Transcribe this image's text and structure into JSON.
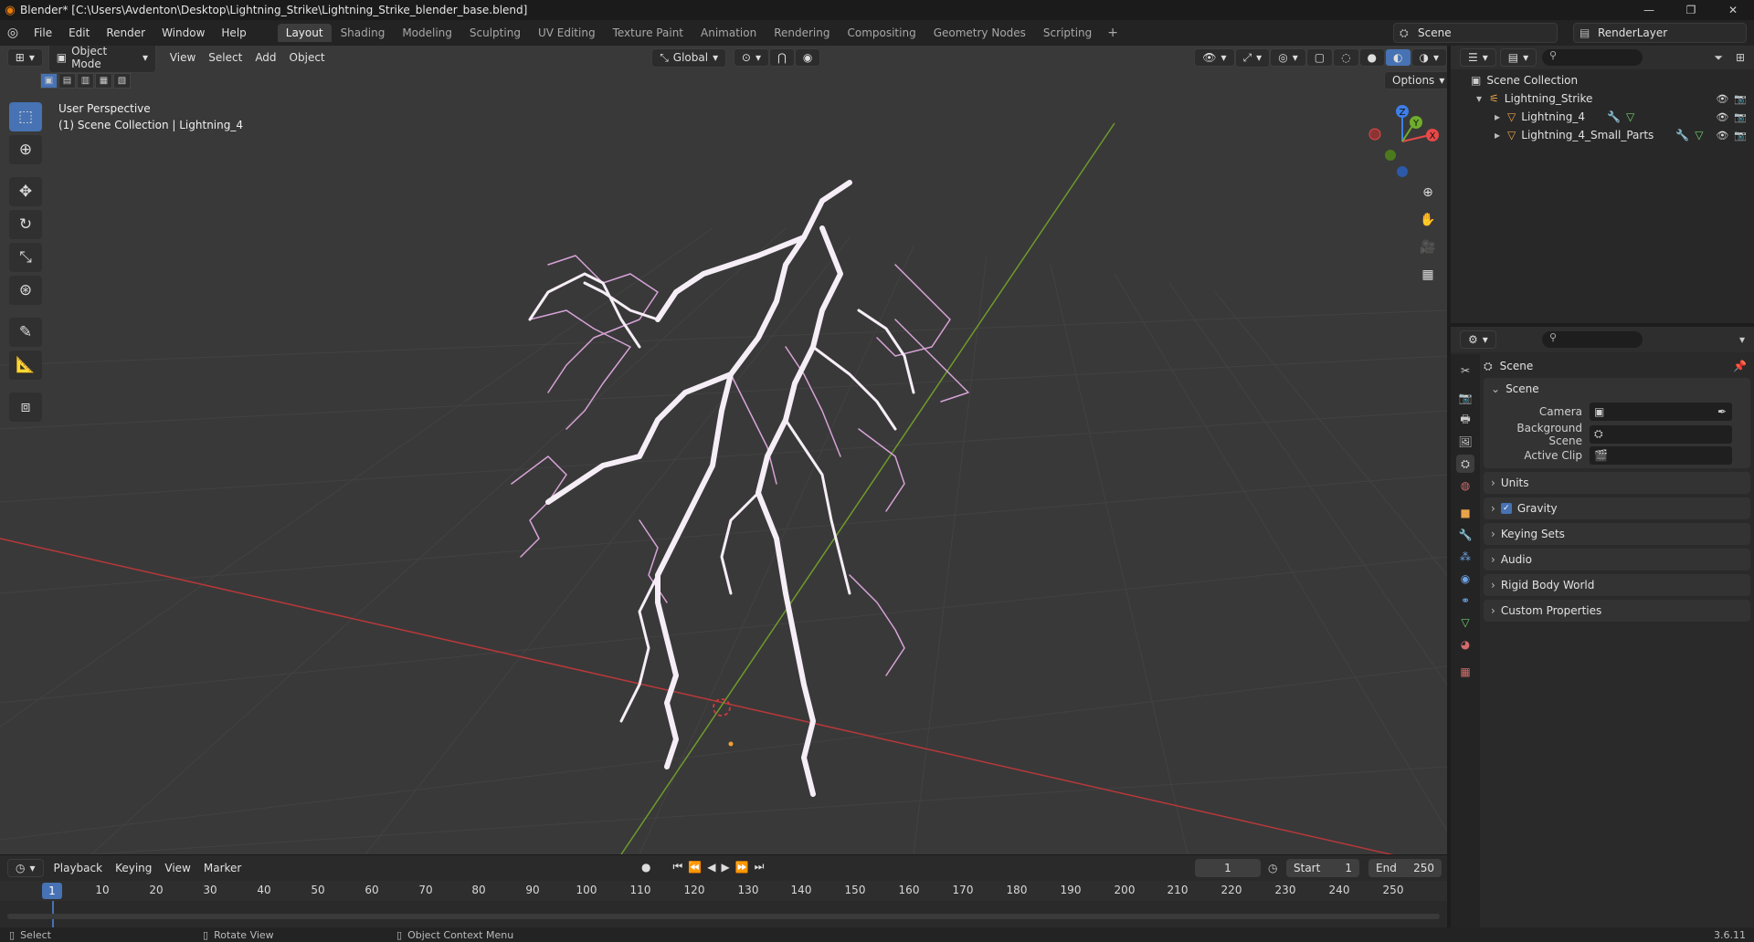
{
  "window": {
    "title": "Blender* [C:\\Users\\Avdenton\\Desktop\\Lightning_Strike\\Lightning_Strike_blender_base.blend]",
    "controls": [
      "—",
      "❐",
      "✕"
    ]
  },
  "menu": [
    "File",
    "Edit",
    "Render",
    "Window",
    "Help"
  ],
  "workspaces": [
    "Layout",
    "Shading",
    "Modeling",
    "Sculpting",
    "UV Editing",
    "Texture Paint",
    "Animation",
    "Rendering",
    "Compositing",
    "Geometry Nodes",
    "Scripting"
  ],
  "active_workspace": "Layout",
  "scene_name": "Scene",
  "view_layer": "RenderLayer",
  "viewport": {
    "mode": "Object Mode",
    "menus": [
      "View",
      "Select",
      "Add",
      "Object"
    ],
    "orientation": "Global",
    "options_label": "Options",
    "info_line1": "User Perspective",
    "info_line2": "(1) Scene Collection | Lightning_4",
    "gizmo_axes": {
      "x": "X",
      "y": "Y",
      "z": "Z"
    },
    "colors": {
      "bg": "#393939",
      "grid": "#444444",
      "x_axis": "#c0393b",
      "y_axis": "#6f9a2b",
      "bolt": "#f6eef6",
      "bolt_glow": "#d7a3d7"
    }
  },
  "outliner": {
    "root": "Scene Collection",
    "collection": "Lightning_Strike",
    "objects": [
      "Lightning_4",
      "Lightning_4_Small_Parts"
    ]
  },
  "properties": {
    "header": "Scene",
    "panel_title": "Scene",
    "fields": [
      {
        "label": "Camera",
        "value": ""
      },
      {
        "label": "Background Scene",
        "value": ""
      },
      {
        "label": "Active Clip",
        "value": ""
      }
    ],
    "sections": [
      "Units",
      "Gravity",
      "Keying Sets",
      "Audio",
      "Rigid Body World",
      "Custom Properties"
    ],
    "gravity_enabled": true
  },
  "timeline": {
    "menus": [
      "Playback",
      "Keying",
      "View",
      "Marker"
    ],
    "current_frame": "1",
    "start_label": "Start",
    "start": "1",
    "end_label": "End",
    "end": "250",
    "ruler": [
      "10",
      "20",
      "30",
      "40",
      "50",
      "60",
      "70",
      "80",
      "90",
      "100",
      "110",
      "120",
      "130",
      "140",
      "150",
      "160",
      "170",
      "180",
      "190",
      "200",
      "210",
      "220",
      "230",
      "240",
      "250"
    ]
  },
  "status": {
    "select": "Select",
    "rotate": "Rotate View",
    "context": "Object Context Menu",
    "version": "3.6.11"
  }
}
